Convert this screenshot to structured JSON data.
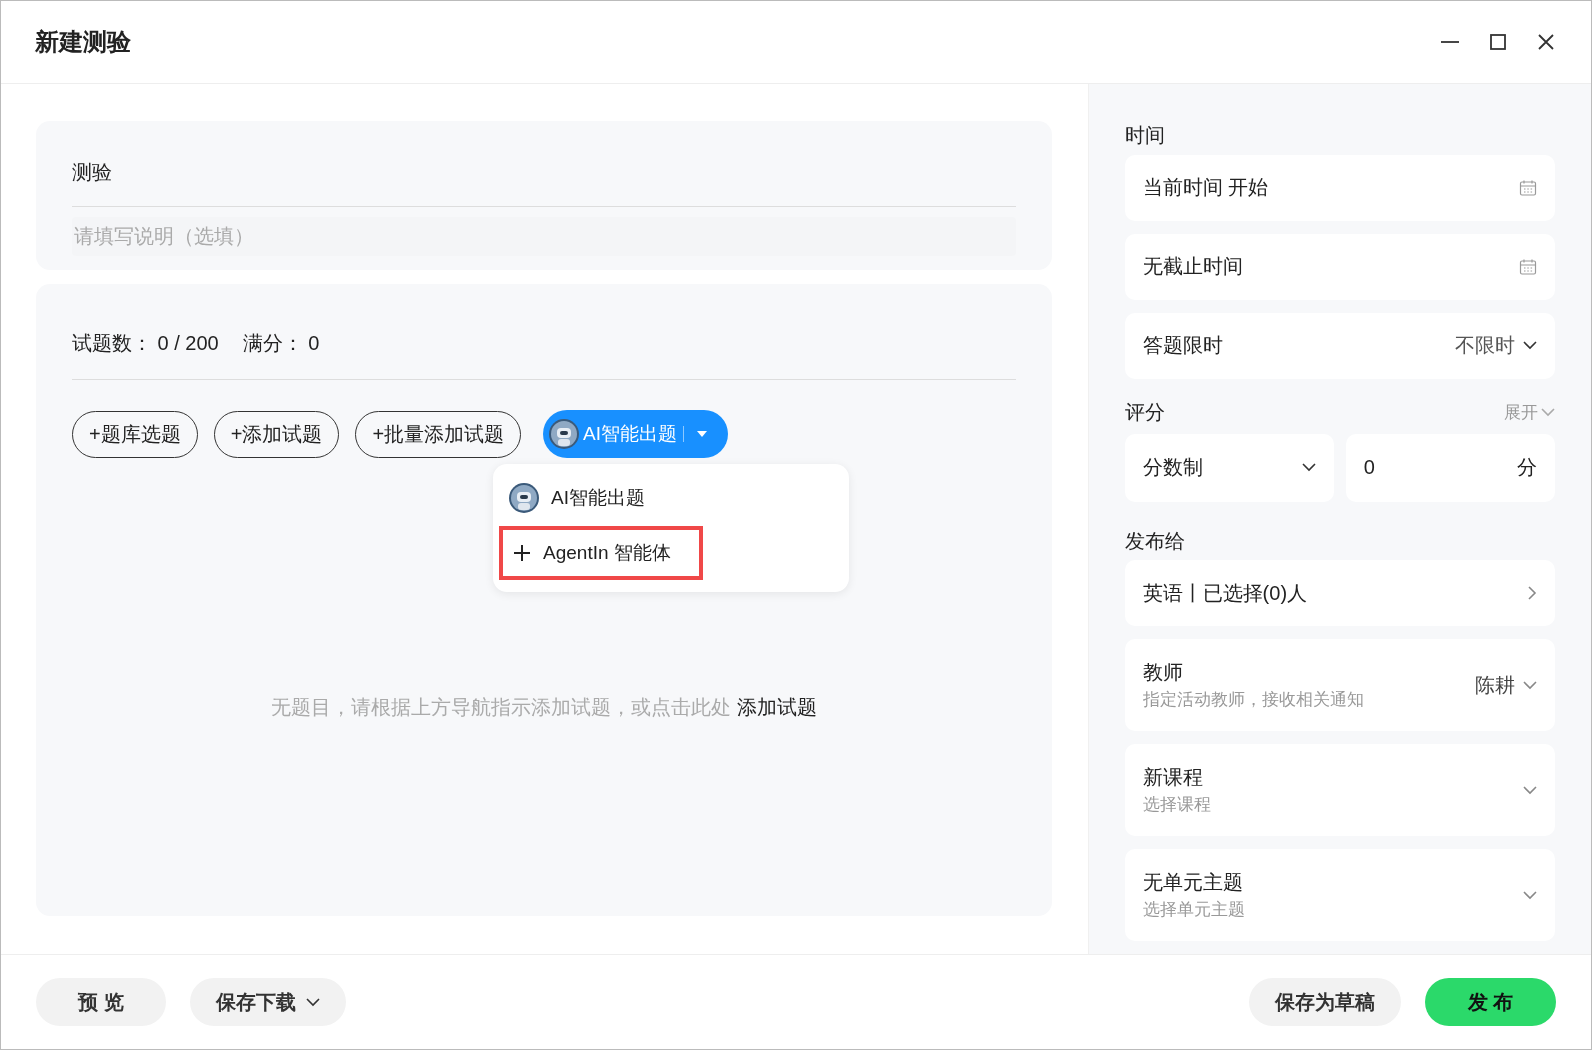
{
  "window": {
    "title": "新建测验"
  },
  "quiz": {
    "title": "测验",
    "description_placeholder": "请填写说明（选填）"
  },
  "questions": {
    "count_label": "试题数：",
    "count": "0 / 200",
    "score_label": "满分：",
    "score": "0"
  },
  "add_buttons": [
    {
      "label": "+题库选题",
      "kind": "outline"
    },
    {
      "label": "+添加试题",
      "kind": "outline"
    },
    {
      "label": "+批量添加试题",
      "kind": "outline"
    },
    {
      "label": "AI智能出题",
      "kind": "ai",
      "expanded": true
    }
  ],
  "ai_menu": [
    {
      "label": "AI智能出题",
      "kind": "avatar",
      "highlighted": false
    },
    {
      "label": "AgentIn 智能体",
      "kind": "add",
      "highlighted": true
    }
  ],
  "empty_state": {
    "message": "无题目，请根据上方导航指示添加试题，或点击此处",
    "link": "添加试题"
  },
  "time": {
    "heading": "时间",
    "start": "当前时间 开始",
    "end": "无截止时间",
    "limit_label": "答题限时",
    "limit_value": "不限时"
  },
  "scoring": {
    "heading": "评分",
    "toggle": "展开",
    "mode": "分数制",
    "points": "0",
    "unit": "分"
  },
  "publish": {
    "heading": "发布给",
    "target": "英语丨已选择(0)人"
  },
  "options": [
    {
      "label": "教师",
      "hint": "指定活动教师，接收相关通知",
      "value": "陈耕"
    },
    {
      "label": "新课程",
      "hint": "选择课程"
    },
    {
      "label": "无单元主题",
      "hint": "选择单元主题"
    }
  ],
  "footer": {
    "left": [
      {
        "label": "预 览",
        "kind": "plain"
      },
      {
        "label": "保存下载",
        "kind": "menu"
      }
    ],
    "right": [
      {
        "label": "保存为草稿",
        "kind": "plain"
      },
      {
        "label": "发 布",
        "kind": "primary"
      }
    ]
  }
}
